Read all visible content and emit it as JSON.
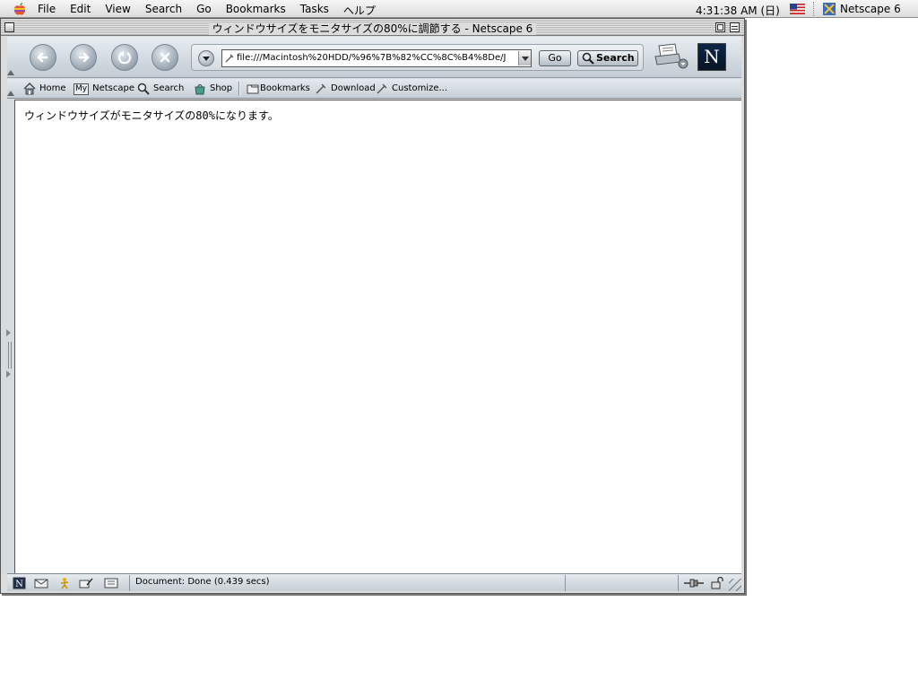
{
  "menubar": {
    "items": [
      "File",
      "Edit",
      "View",
      "Search",
      "Go",
      "Bookmarks",
      "Tasks",
      "ヘルプ"
    ],
    "clock": "4:31:38 AM (日)",
    "app_name": "Netscape 6"
  },
  "window": {
    "title": "ウィンドウサイズをモニタサイズの80%に調節する - Netscape 6"
  },
  "navbar": {
    "url": "file:///Macintosh%20HDD/%96%7B%82%CC%8C%B4%8De/J",
    "go_label": "Go",
    "search_label": "Search",
    "logo_letter": "N"
  },
  "personal_toolbar": {
    "home": "Home",
    "netscape_badge": "My",
    "netscape": "Netscape",
    "search": "Search",
    "shop": "Shop",
    "bookmarks": "Bookmarks",
    "download": "Download",
    "customize": "Customize..."
  },
  "content": {
    "text": "ウィンドウサイズがモニタサイズの80%になります。"
  },
  "statusbar": {
    "text": "Document: Done (0.439 secs)"
  }
}
